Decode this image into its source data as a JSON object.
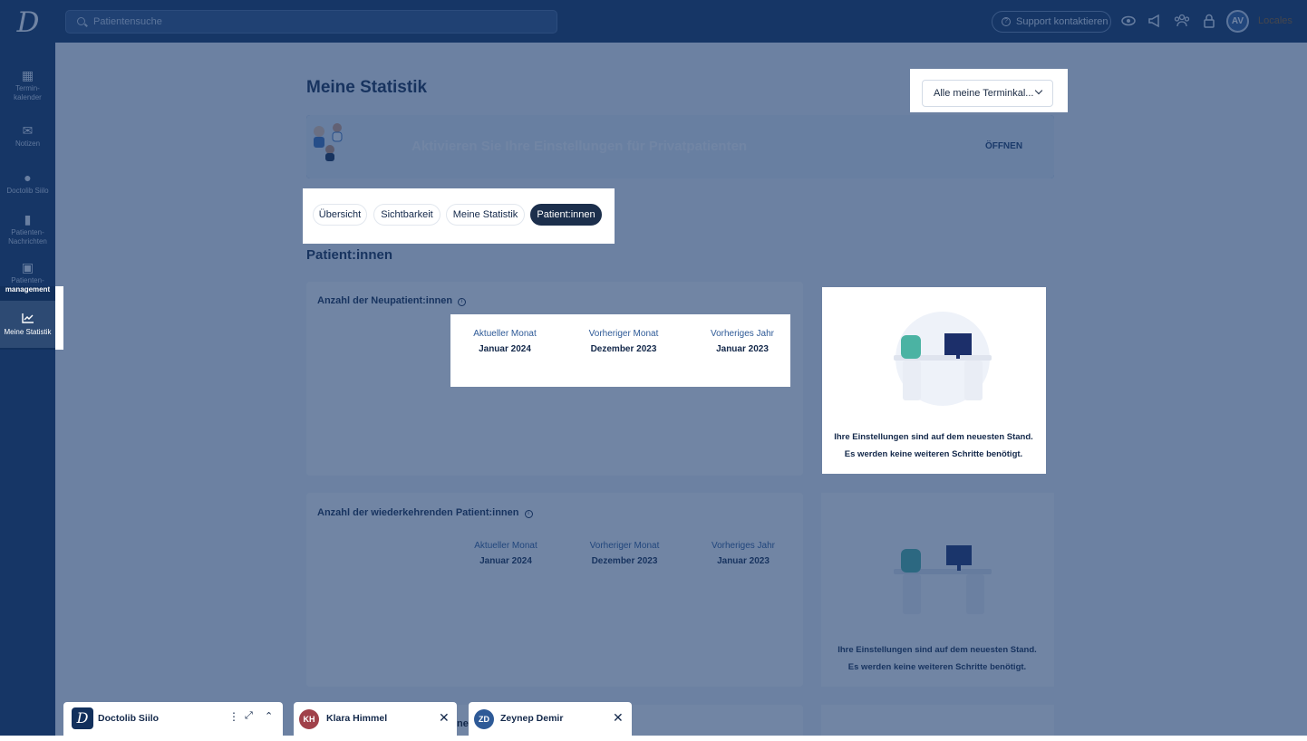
{
  "topbar": {
    "search_placeholder": "Patientensuche",
    "support_label": "Support kontaktieren",
    "avatar_initials": "AV",
    "locales_label": "Locales",
    "icons": [
      "eye-icon",
      "megaphone-icon",
      "team-icon",
      "lock-icon"
    ]
  },
  "sidebar": {
    "items": [
      {
        "label": "Termin-\nkalender",
        "icon": "calendar-icon"
      },
      {
        "label": "Notizen",
        "icon": "mail-icon"
      },
      {
        "label": "Doctolib Siilo",
        "icon": "chat-icon"
      },
      {
        "label": "Patienten-\nNachrichten",
        "icon": "message-icon"
      },
      {
        "label": "Patienten-",
        "label2": "management",
        "icon": "clipboard-icon"
      },
      {
        "label": "Meine Statistik",
        "icon": "chart-icon"
      }
    ]
  },
  "page": {
    "title": "Meine Statistik",
    "dropdown_value": "Alle meine Terminkal...",
    "banner_title": "Aktivieren Sie Ihre Einstellungen für Privatpatienten",
    "banner_button": "ÖFFNEN",
    "tabs": [
      "Übersicht",
      "Sichtbarkeit",
      "Meine Statistik",
      "Patient:innen"
    ],
    "active_tab": "Patient:innen",
    "section_title": "Patient:innen"
  },
  "cards": [
    {
      "title": "Anzahl der Neupatient:innen",
      "columns": [
        {
          "label": "Aktueller Monat",
          "value": "Januar 2024"
        },
        {
          "label": "Vorheriger Monat",
          "value": "Dezember 2023"
        },
        {
          "label": "Vorheriges Jahr",
          "value": "Januar 2023"
        }
      ],
      "side_message_line1": "Ihre Einstellungen sind auf dem neuesten Stand.",
      "side_message_line2": "Es werden keine weiteren Schritte benötigt."
    },
    {
      "title": "Anzahl der wiederkehrenden Patient:innen",
      "columns": [
        {
          "label": "Aktueller Monat",
          "value": "Januar 2024"
        },
        {
          "label": "Vorheriger Monat",
          "value": "Dezember 2023"
        },
        {
          "label": "Vorheriges Jahr",
          "value": "Januar 2023"
        }
      ],
      "side_message_line1": "Ihre Einstellungen sind auf dem neuesten Stand.",
      "side_message_line2": "Es werden keine weiteren Schritte benötigt."
    }
  ],
  "dock": {
    "siilo_label": "Doctolib Siilo",
    "chats": [
      {
        "initials": "KH",
        "name": "Klara Himmel",
        "color": "#a0414a"
      },
      {
        "initials": "ZD",
        "name": "Zeynep Demir",
        "color": "#2e5a97"
      }
    ],
    "partial_text": "ne"
  },
  "colors": {
    "navy": "#12305c",
    "accent": "#2e5a97",
    "overlay": "#1a3a6c"
  }
}
